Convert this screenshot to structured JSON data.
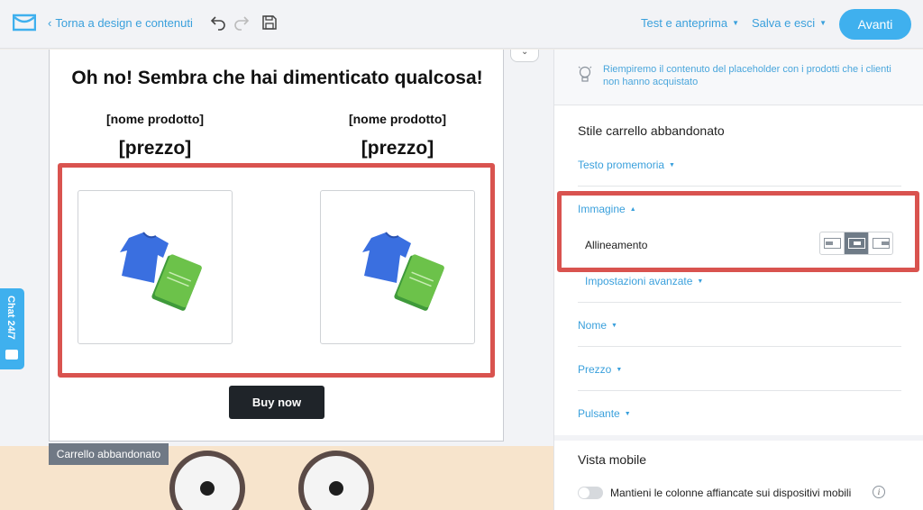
{
  "topbar": {
    "back_label": "Torna a design e contenuti",
    "test_label": "Test e anteprima",
    "save_label": "Salva e esci",
    "next_label": "Avanti"
  },
  "email": {
    "title": "Oh no! Sembra che hai dimenticato qualcosa!",
    "products": [
      {
        "name": "[nome prodotto]",
        "price": "[prezzo]"
      },
      {
        "name": "[nome prodotto]",
        "price": "[prezzo]"
      }
    ],
    "button_label": "Buy now",
    "block_label": "Carrello abbandonato"
  },
  "chat": {
    "label": "Chat 24/7"
  },
  "panel": {
    "hint": "Riempiremo il contenuto del placeholder con i prodotti che i clienti non hanno acquistato",
    "section_title": "Stile carrello abbandonato",
    "reminder_link": "Testo promemoria",
    "image_link": "Immagine",
    "alignment_label": "Allineamento",
    "alignment_selected": "center",
    "advanced_link": "Impostazioni avanzate",
    "name_link": "Nome",
    "price_link": "Prezzo",
    "button_link": "Pulsante",
    "mobile_title": "Vista mobile",
    "mobile_toggle_label": "Mantieni le colonne affiancate sui dispositivi mobili",
    "mobile_toggle_on": false
  },
  "colors": {
    "accent": "#3fb0ee",
    "highlight": "#d9534f",
    "link": "#3aa0dc"
  }
}
